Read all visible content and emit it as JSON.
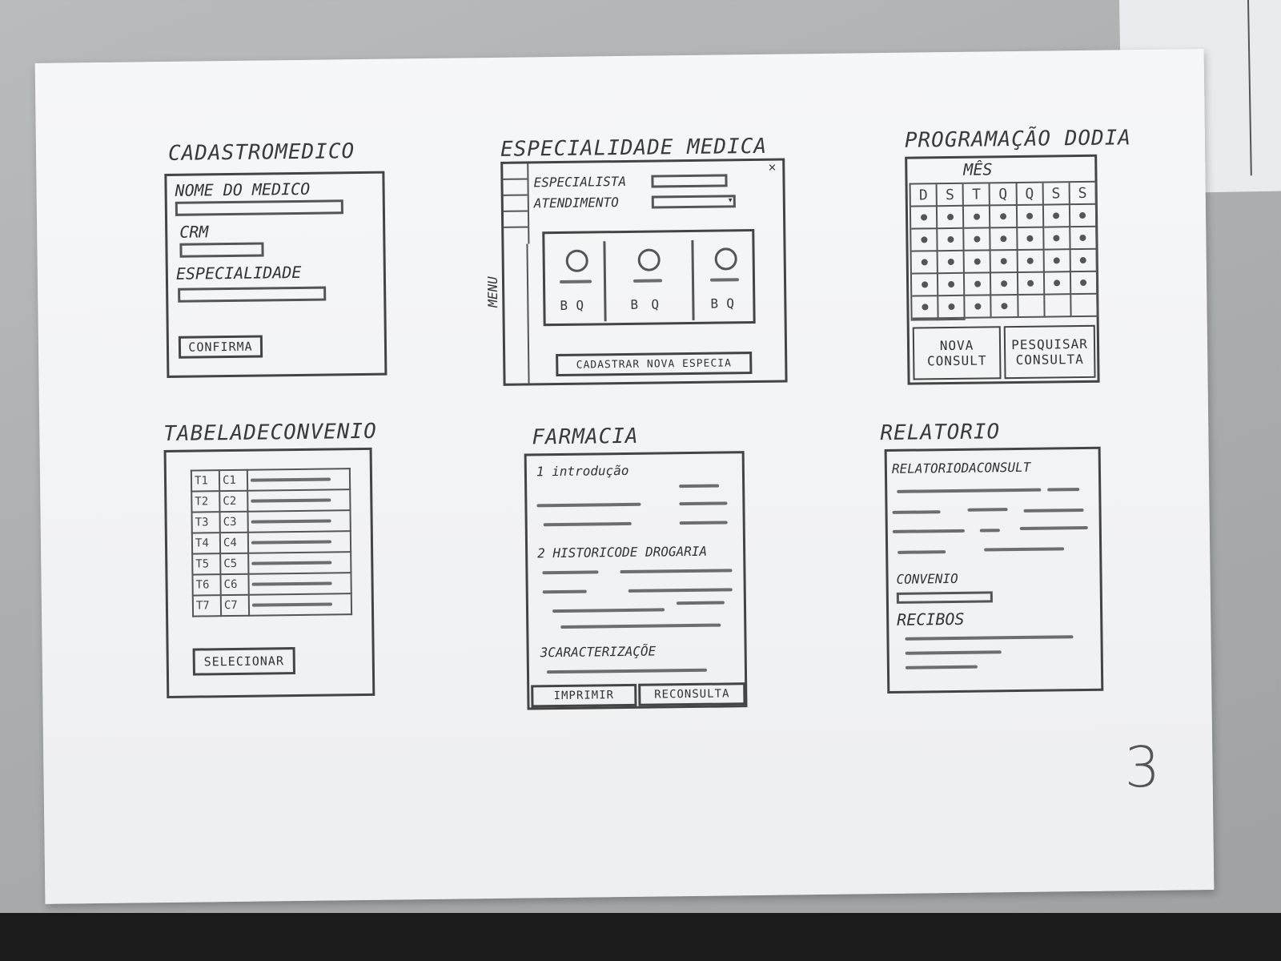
{
  "screens": {
    "cadastro": {
      "title": "CADASTROMEDICO",
      "name_label": "NOME DO MEDICO",
      "crm_label": "CRM",
      "especialidade_label": "ESPECIALIDADE",
      "confirm_button": "CONFIRMA"
    },
    "especialidade": {
      "title": "ESPECIALIDADE MEDICA",
      "menu_label": "MENU",
      "especialista_label": "ESPECIALISTA",
      "atendimento_label": "ATENDIMENTO",
      "register_button": "CADASTRAR NOVA ESPECIA"
    },
    "programacao": {
      "title": "PROGRAMAÇÃO DODIA",
      "month_label": "MÊS",
      "weekdays": [
        "D",
        "S",
        "T",
        "Q",
        "Q",
        "S",
        "S"
      ],
      "new_button_line1": "NOVA",
      "new_button_line2": "CONSULT",
      "search_button_line1": "PESQUISAR",
      "search_button_line2": "CONSULTA"
    },
    "convenio": {
      "title": "TABELADECONVENIO",
      "rows": [
        [
          "T1",
          "C1"
        ],
        [
          "T2",
          "C2"
        ],
        [
          "T3",
          "C3"
        ],
        [
          "T4",
          "C4"
        ],
        [
          "T5",
          "C5"
        ],
        [
          "T6",
          "C6"
        ],
        [
          "T7",
          "C7"
        ]
      ],
      "select_button": "SELECIONAR"
    },
    "farmacia": {
      "title": "FARMACIA",
      "section1": "1 introdução",
      "section2": "2 HISTORICODE DROGARIA",
      "section3": "3CARACTERIZAÇÕE",
      "print_button": "IMPRIMIR",
      "reconsult_button": "RECONSULTA"
    },
    "relatorio": {
      "title": "RELATORIO",
      "heading": "RELATORIODACONSULT",
      "convenio_label": "CONVENIO",
      "recibos_label": "RECIBOS"
    }
  },
  "page_number": "3"
}
